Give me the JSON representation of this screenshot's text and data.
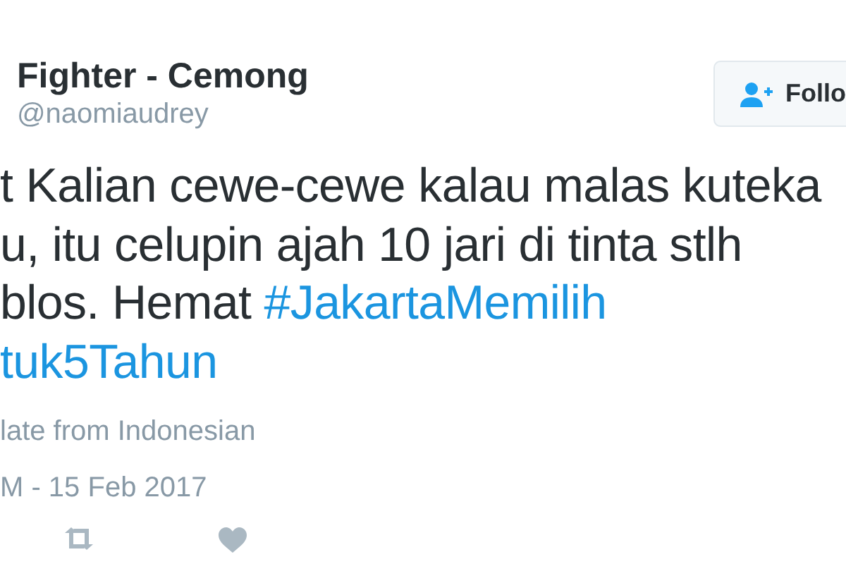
{
  "user": {
    "name": "Fighter - Cemong",
    "handle": "@naomiaudrey"
  },
  "follow_button": {
    "label": "Follo"
  },
  "tweet_lines": [
    {
      "parts": [
        {
          "kind": "text",
          "text": "t Kalian cewe-cewe kalau malas kuteka"
        }
      ]
    },
    {
      "parts": [
        {
          "kind": "text",
          "text": "u, itu celupin ajah 10 jari di tinta stlh"
        }
      ]
    },
    {
      "parts": [
        {
          "kind": "text",
          "text": "blos. Hemat "
        },
        {
          "kind": "hashtag",
          "text": "#JakartaMemilih"
        }
      ]
    },
    {
      "parts": [
        {
          "kind": "hashtag",
          "text": "tuk5Tahun"
        }
      ]
    }
  ],
  "translate_link": "late from Indonesian",
  "timestamp": "M - 15 Feb 2017"
}
